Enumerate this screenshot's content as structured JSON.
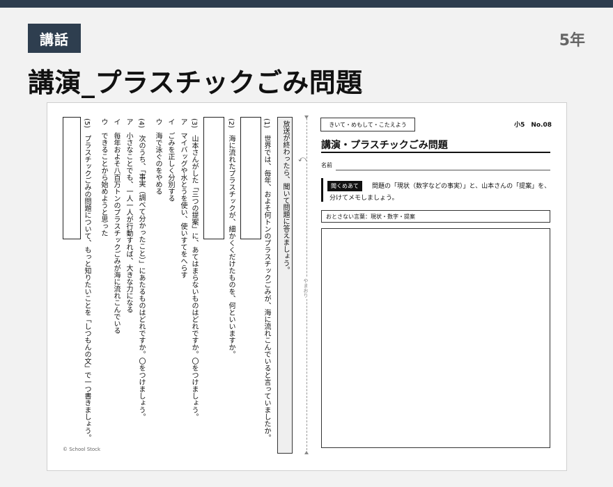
{
  "header": {
    "category_badge": "講話",
    "grade": "5年",
    "title": "講演_プラスチックごみ問題"
  },
  "worksheet": {
    "sub_tag": "きいて・めもして・こたえよう",
    "grade_number": "小5　No.08",
    "title": "講演・プラスチックごみ問題",
    "name_label": "名前",
    "task_chip": "聞くめあて",
    "task_line1": "問題の「現状（数字などの事実）」と、山本さんの「提案」を、",
    "task_line2": "分けてメモしましょう。",
    "keywords": "おとさない言葉：現状・数字・提案",
    "fold_label": "やまおり",
    "instruction": "放送が終わったら、聞いて問題に答えましょう。",
    "q1": "(1)　世界では、毎年、およそ何トンのプラスチックごみが、海に流れこんでいると言っていましたか。",
    "q2": "(2)　海に流れたプラスチックが、細かくくだけたものを、何といいますか。",
    "q3": "(3)　山本さんがした「三つの提案」に、あてはまらないものはどれですか。〇をつけましょう。",
    "q3_options": [
      "ア　マイバッグや水とうを使い、使いすてをへらす",
      "イ　ごみを正しく分別する",
      "ウ　海で泳ぐのをやめる"
    ],
    "q4": "(4)　次のうち、「事実（調べて分かったこと）」にあたるものはどれですか。〇をつけましょう。",
    "q4_options": [
      "ア　小さなことでも、一人一人が行動すれば、大きな力になる",
      "イ　毎年およそ八百万トンのプラスチックごみが海に流れこんでいる",
      "ウ　できることから始めようと思った"
    ],
    "q5": "(5)　プラスチックごみの問題について、もっと知りたいことを「しつもんの文」で一つ書きましょう。",
    "copyright": "© School Stock"
  }
}
